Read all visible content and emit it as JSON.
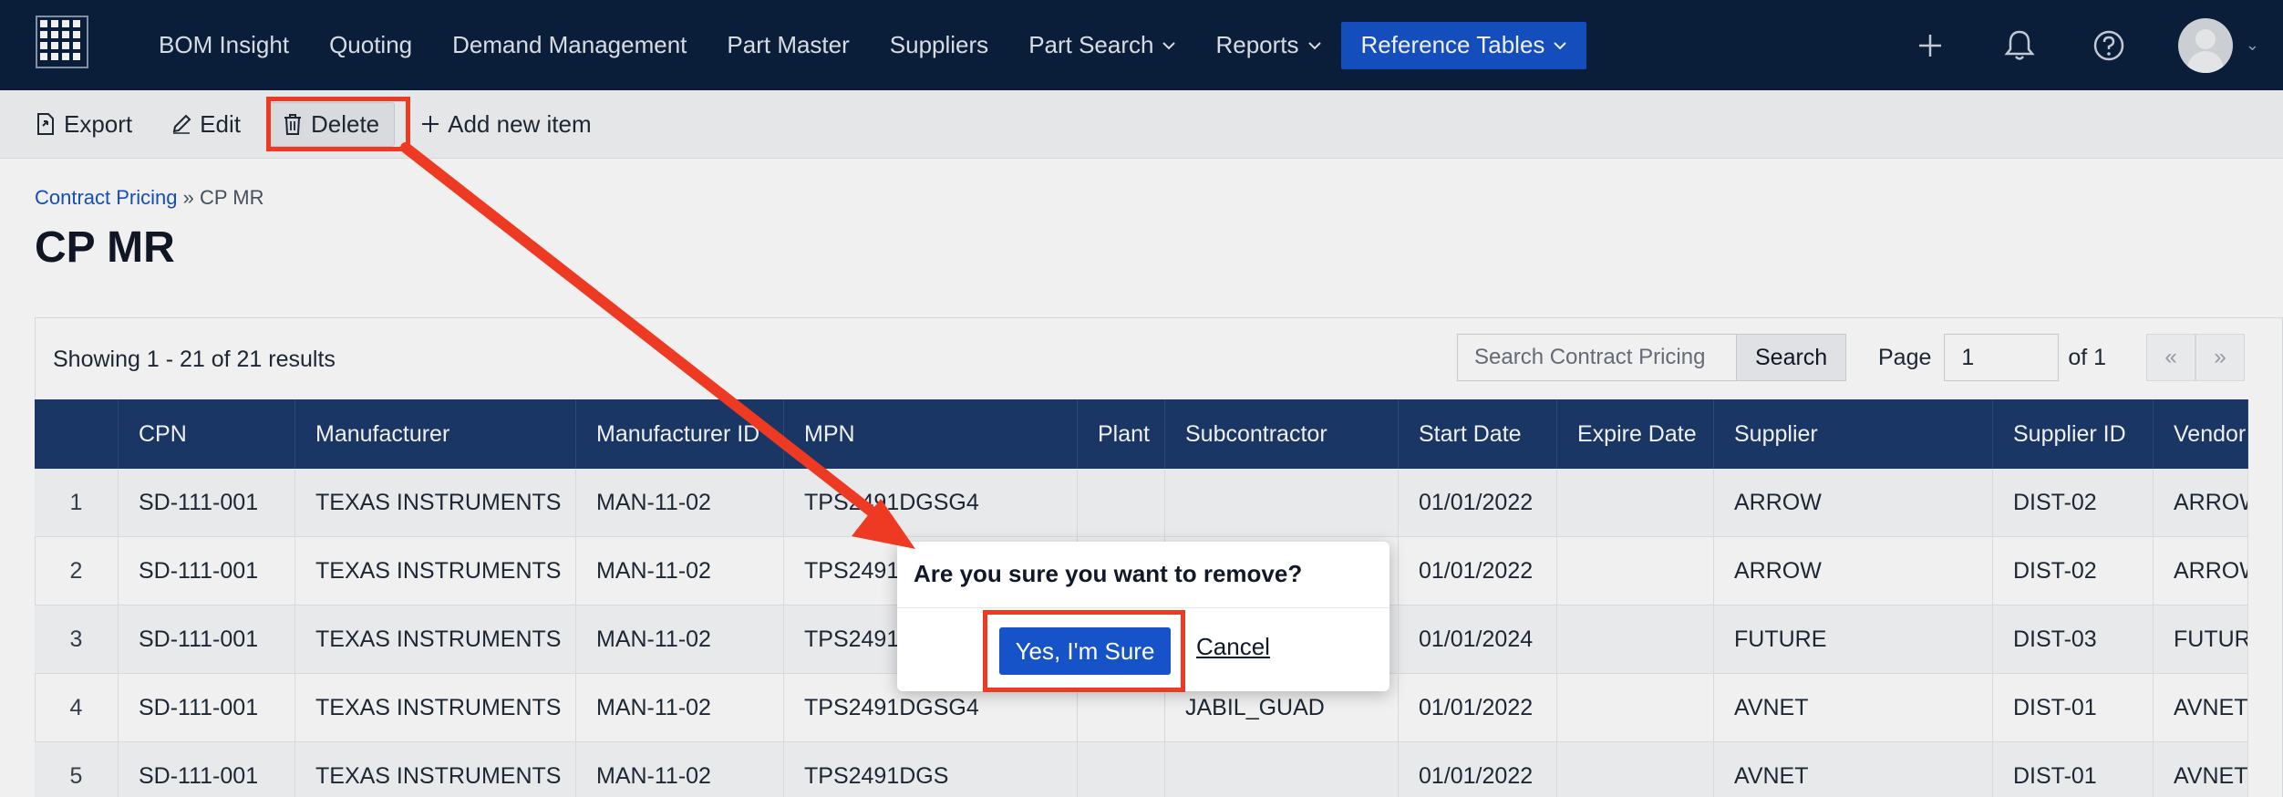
{
  "nav": {
    "items": [
      {
        "label": "BOM Insight",
        "dropdown": false,
        "active": false
      },
      {
        "label": "Quoting",
        "dropdown": false,
        "active": false
      },
      {
        "label": "Demand Management",
        "dropdown": false,
        "active": false
      },
      {
        "label": "Part Master",
        "dropdown": false,
        "active": false
      },
      {
        "label": "Suppliers",
        "dropdown": false,
        "active": false
      },
      {
        "label": "Part Search",
        "dropdown": true,
        "active": false
      },
      {
        "label": "Reports",
        "dropdown": true,
        "active": false
      },
      {
        "label": "Reference Tables",
        "dropdown": true,
        "active": true
      }
    ],
    "icons": [
      "grid-logo-icon",
      "plus-icon",
      "bell-icon",
      "help-icon",
      "avatar"
    ]
  },
  "toolbar": {
    "export_label": "Export",
    "edit_label": "Edit",
    "delete_label": "Delete",
    "add_label": "Add new item"
  },
  "breadcrumb": {
    "parent": "Contract Pricing",
    "separator": "»",
    "current": "CP MR"
  },
  "page_title": "CP MR",
  "results": {
    "summary": "Showing 1 - 21 of 21 results",
    "search_placeholder": "Search Contract Pricing",
    "search_button": "Search",
    "page_label": "Page",
    "page_value": "1",
    "page_of": "of 1",
    "prev": "«",
    "next": "»"
  },
  "table": {
    "columns": [
      "",
      "CPN",
      "Manufacturer",
      "Manufacturer ID",
      "MPN",
      "Plant",
      "Subcontractor",
      "Start Date",
      "Expire Date",
      "Supplier",
      "Supplier ID",
      "Vendor"
    ],
    "rows": [
      [
        "1",
        "SD-111-001",
        "TEXAS INSTRUMENTS",
        "MAN-11-02",
        "TPS2491DGSG4",
        "",
        "",
        "01/01/2022",
        "",
        "ARROW",
        "DIST-02",
        "ARROW"
      ],
      [
        "2",
        "SD-111-001",
        "TEXAS INSTRUMENTS",
        "MAN-11-02",
        "TPS2491",
        "",
        "",
        "01/01/2022",
        "",
        "ARROW",
        "DIST-02",
        "ARROW"
      ],
      [
        "3",
        "SD-111-001",
        "TEXAS INSTRUMENTS",
        "MAN-11-02",
        "TPS2491",
        "",
        "",
        "01/01/2024",
        "",
        "FUTURE",
        "DIST-03",
        "FUTUR"
      ],
      [
        "4",
        "SD-111-001",
        "TEXAS INSTRUMENTS",
        "MAN-11-02",
        "TPS2491DGSG4",
        "",
        "JABIL_GUAD",
        "01/01/2022",
        "",
        "AVNET",
        "DIST-01",
        "AVNET"
      ],
      [
        "5",
        "SD-111-001",
        "TEXAS INSTRUMENTS",
        "MAN-11-02",
        "TPS2491DGS",
        "",
        "",
        "01/01/2022",
        "",
        "AVNET",
        "DIST-01",
        "AVNET"
      ]
    ]
  },
  "dialog": {
    "message": "Are you sure you want to remove?",
    "confirm_label": "Yes, I'm Sure",
    "cancel_label": "Cancel"
  },
  "colors": {
    "nav_bg": "#0b1f3d",
    "active_tab": "#1652c8",
    "table_header": "#1b3a6b",
    "annotation": "#ee3a22",
    "confirm_button": "#1652c8"
  }
}
